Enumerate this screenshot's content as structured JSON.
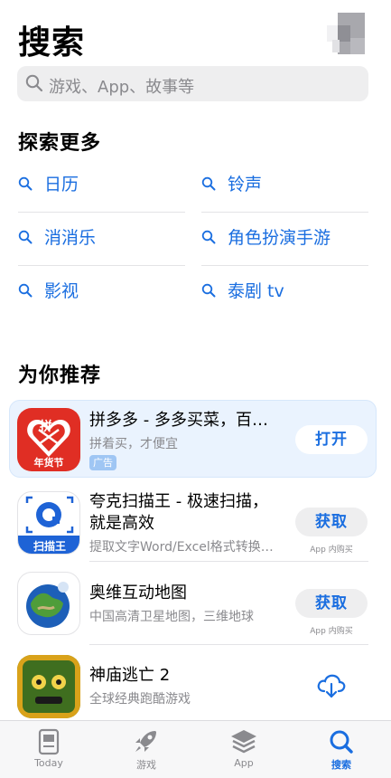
{
  "header": {
    "title": "搜索"
  },
  "search": {
    "placeholder": "游戏、App、故事等"
  },
  "discover": {
    "title": "探索更多",
    "items": [
      "日历",
      "铃声",
      "消消乐",
      "角色扮演手游",
      "影视",
      "泰剧 tv"
    ]
  },
  "recommend": {
    "title": "为你推荐",
    "apps": [
      {
        "name": "拼多多 - 多多买菜，百…",
        "subtitle": "拼着买，才便宜",
        "badge": "广告",
        "button": "打开",
        "icon_text_1": "拼",
        "icon_text_2": "年货节"
      },
      {
        "name_line1": "夸克扫描王 - 极速扫描，",
        "name_line2": "就是高效",
        "subtitle": "提取文字Word/Excel格式转换…",
        "button": "获取",
        "iap": "App 内购买",
        "icon_text": "扫描王"
      },
      {
        "name": "奥维互动地图",
        "subtitle": "中国高清卫星地图，三维地球",
        "button": "获取",
        "iap": "App 内购买"
      },
      {
        "name": "神庙逃亡 2",
        "subtitle": "全球经典跑酷游戏",
        "button_icon": "cloud-download-icon"
      }
    ]
  },
  "tabbar": {
    "items": [
      {
        "label": "Today",
        "icon": "today-icon",
        "active": false
      },
      {
        "label": "游戏",
        "icon": "rocket-icon",
        "active": false
      },
      {
        "label": "App",
        "icon": "app-stack-icon",
        "active": false
      },
      {
        "label": "搜索",
        "icon": "search-icon",
        "active": true
      }
    ]
  },
  "colors": {
    "accent": "#1a6ee0",
    "pdd_red": "#e02e24",
    "quark_blue": "#1e63d6"
  }
}
